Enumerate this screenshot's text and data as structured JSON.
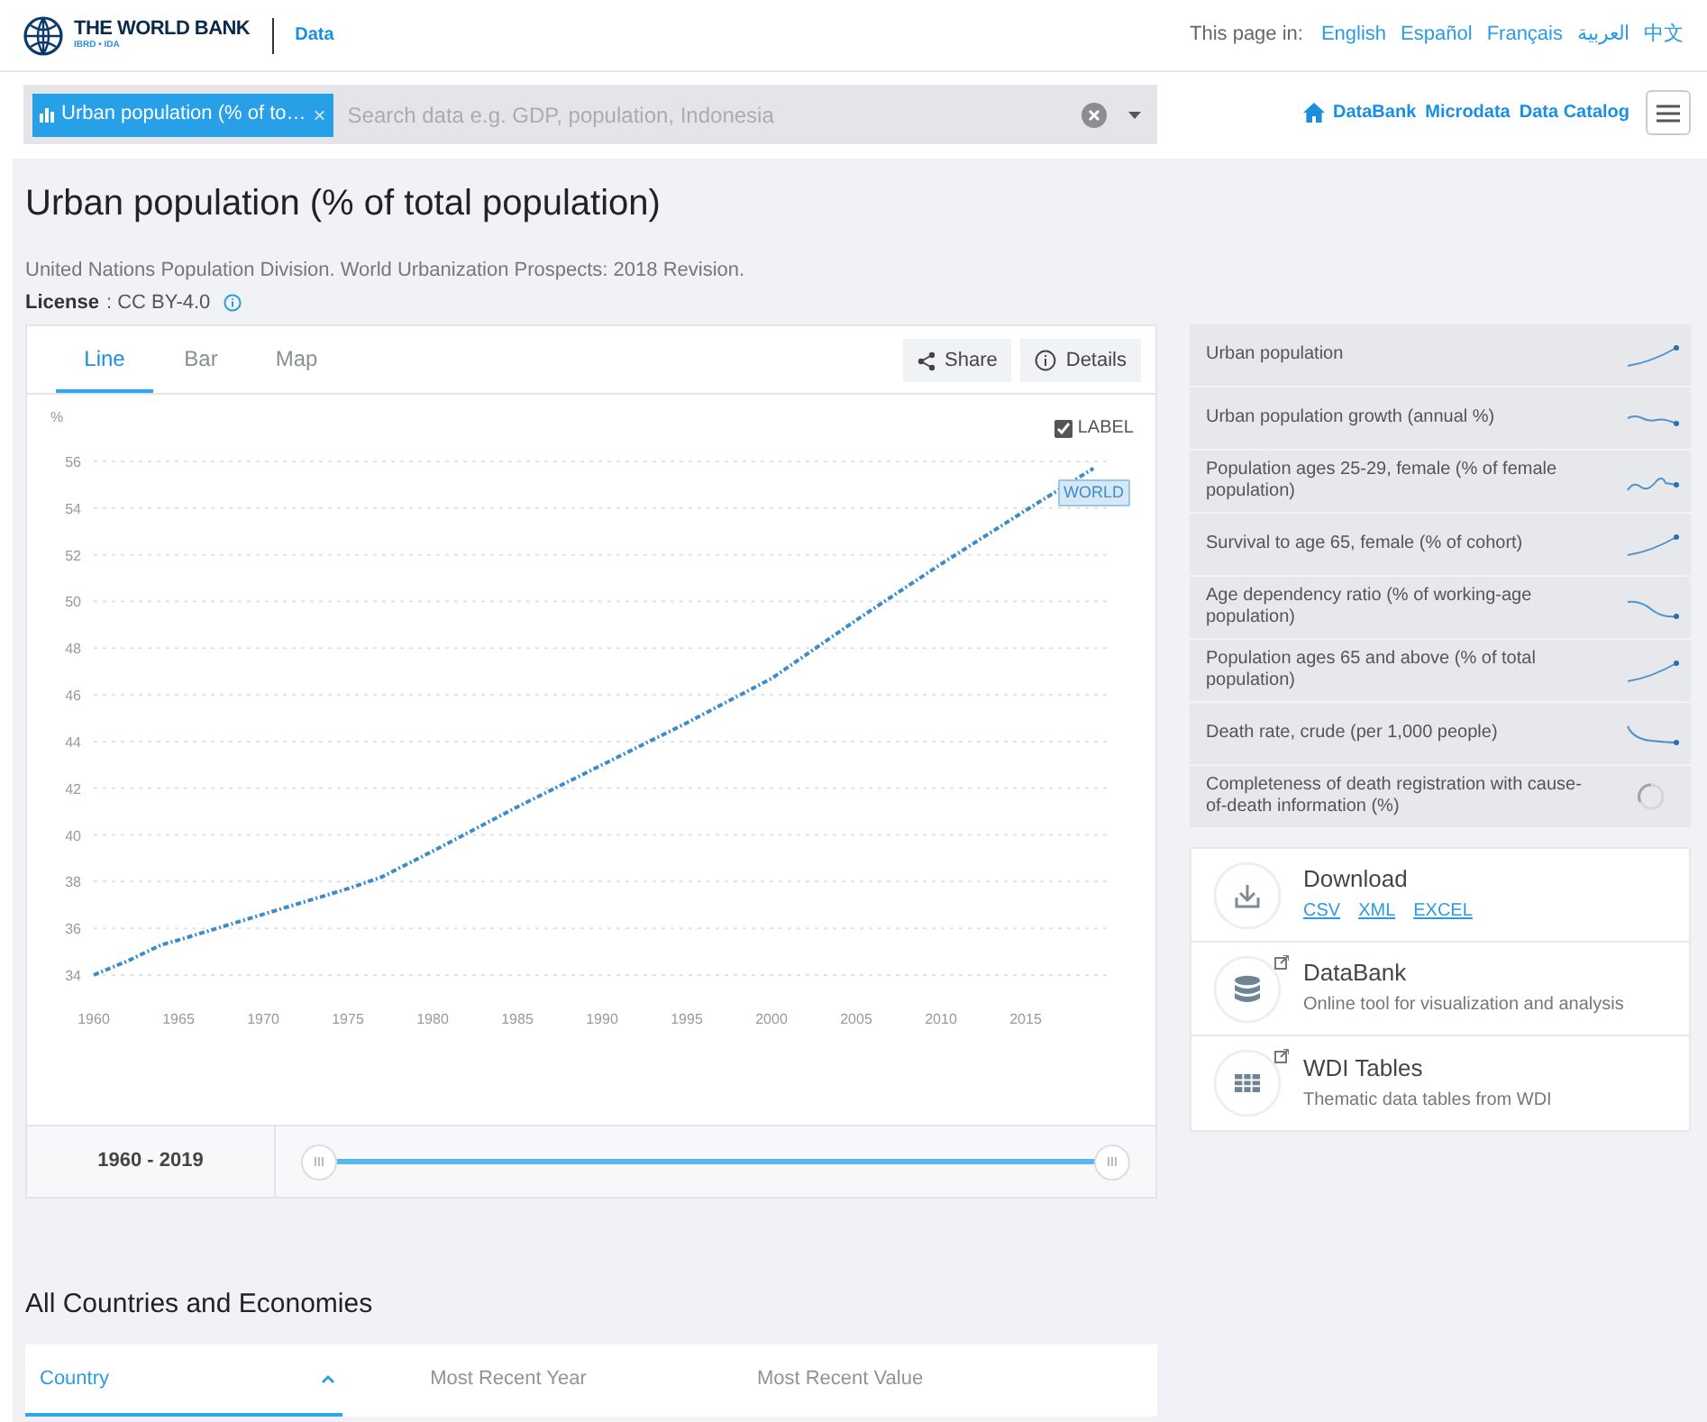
{
  "header": {
    "logo_text": "THE WORLD BANK",
    "logo_subtext": "IBRD • IDA",
    "section": "Data",
    "languages_label": "This page in:",
    "languages": [
      "English",
      "Español",
      "Français",
      "العربية",
      "中文"
    ]
  },
  "search": {
    "chip": "Urban population (% of to…",
    "chip_close": "×",
    "placeholder": "Search data e.g. GDP, population, Indonesia"
  },
  "nav_links": [
    {
      "label": "DataBank",
      "kind": "home"
    },
    {
      "label": "Microdata"
    },
    {
      "label": "Data Catalog"
    }
  ],
  "indicator": {
    "title": "Urban population (% of total population)",
    "source": "United Nations Population Division. World Urbanization Prospects: 2018 Revision.",
    "license_label": "License",
    "license_value": ": CC BY-4.0"
  },
  "chart_tabs": [
    {
      "label": "Line",
      "selected": true
    },
    {
      "label": "Bar",
      "selected": false
    },
    {
      "label": "Map",
      "selected": false
    }
  ],
  "chart_actions": [
    {
      "label": "Share",
      "kind": "share"
    },
    {
      "label": "Details",
      "kind": "info"
    }
  ],
  "chart": {
    "label_toggle": {
      "label": "LABEL",
      "checked": true
    },
    "chart_data": {
      "type": "line",
      "ylabel": "%",
      "grid": true,
      "xlim": [
        1960,
        2020
      ],
      "ylim": [
        34,
        56
      ],
      "x": [
        1960,
        1962,
        1964,
        1965,
        1970,
        1975,
        1977,
        1980,
        1985,
        1990,
        1995,
        2000,
        2005,
        2010,
        2015,
        2019
      ],
      "series": [
        {
          "name": "WORLD",
          "color": "#3a8ccb",
          "line_style": "dashed",
          "values": [
            34.0,
            34.6,
            35.3,
            35.5,
            36.6,
            37.7,
            38.2,
            39.3,
            41.2,
            43.0,
            44.8,
            46.7,
            49.2,
            51.6,
            53.9,
            55.7
          ]
        }
      ],
      "xticks": [
        1960,
        1965,
        1970,
        1975,
        1980,
        1985,
        1990,
        1995,
        2000,
        2005,
        2010,
        2015
      ],
      "yticks": [
        34,
        36,
        38,
        40,
        42,
        44,
        46,
        48,
        50,
        52,
        54,
        56
      ]
    }
  },
  "range": {
    "label": "1960 - 2019"
  },
  "related": [
    {
      "label": "Urban population",
      "kind": "rising"
    },
    {
      "label": "Urban population growth (annual %)",
      "kind": "flat"
    },
    {
      "label": "Population ages 25-29, female (% of female population)",
      "kind": "wavy"
    },
    {
      "label": "Survival to age 65, female (% of cohort)",
      "kind": "rising"
    },
    {
      "label": "Age dependency ratio (% of working-age population)",
      "kind": "falling"
    },
    {
      "label": "Population ages 65 and above (% of total population)",
      "kind": "rising"
    },
    {
      "label": "Death rate, crude (per 1,000 people)",
      "kind": "dropping"
    },
    {
      "label": "Completeness of death registration with cause-of-death information (%)",
      "kind": "loading"
    }
  ],
  "resources": [
    {
      "title": "Download",
      "kind": "download",
      "external": false,
      "links": [
        "CSV",
        "XML",
        "EXCEL"
      ]
    },
    {
      "title": "DataBank",
      "kind": "database",
      "external": true,
      "subtitle": "Online tool for visualization and analysis"
    },
    {
      "title": "WDI Tables",
      "kind": "table",
      "external": true,
      "subtitle": "Thematic data tables from WDI"
    }
  ],
  "countries": {
    "title": "All Countries and Economies",
    "columns": [
      {
        "label": "Country",
        "selected": true,
        "sorted": true
      },
      {
        "label": "Most Recent Year",
        "selected": false
      },
      {
        "label": "Most Recent Value",
        "selected": false
      }
    ]
  }
}
